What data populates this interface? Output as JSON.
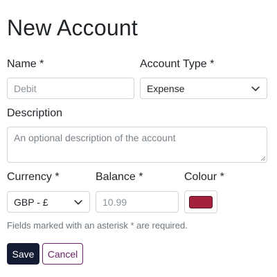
{
  "page": {
    "title": "New Account"
  },
  "form": {
    "name": {
      "label": "Name *",
      "placeholder": "Debit"
    },
    "account_type": {
      "label": "Account Type *",
      "selected": "Expense"
    },
    "description": {
      "label": "Description",
      "placeholder": "An optional description of the account"
    },
    "currency": {
      "label": "Currency *",
      "selected": "GBP - £"
    },
    "balance": {
      "label": "Balance *",
      "placeholder": "10.99"
    },
    "colour": {
      "label": "Colour *",
      "value": "#a3213d"
    },
    "help_text": "Fields marked with an asterisk * are required."
  },
  "actions": {
    "save_label": "Save",
    "cancel_label": "Cancel"
  },
  "colors": {
    "primary": "#141c33",
    "secondary_outline": "#6b2466",
    "border": "#ced4da"
  },
  "icons": {
    "select_caret": "chevron-down-icon"
  }
}
